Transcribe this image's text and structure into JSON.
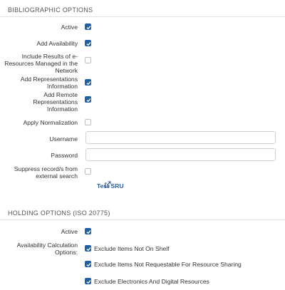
{
  "bibliographic": {
    "title": "BIBLIOGRAPHIC OPTIONS",
    "active_label": "Active",
    "active_checked": true,
    "add_availability_label": "Add Availability",
    "add_availability_checked": true,
    "include_results_label_1": "Include Results of e-",
    "include_results_label_2": "Resources Managed in the",
    "include_results_label_3": "Network",
    "include_results_checked": false,
    "add_representations_label_1": "Add Representations",
    "add_representations_label_2": "Information",
    "add_representations_checked": true,
    "add_remote_label_1": "Add Remote",
    "add_remote_label_2": "Representations",
    "add_remote_label_3": "Information",
    "add_remote_checked": true,
    "apply_normalization_label": "Apply Normalization",
    "apply_normalization_checked": false,
    "username_label": "Username",
    "username_value": "",
    "password_label": "Password",
    "password_value": "",
    "suppress_label_1": "Suppress record/s from",
    "suppress_label_2": "external search",
    "suppress_checked": false,
    "test_sru_label": "Test SRU"
  },
  "holding": {
    "title": "HOLDING OPTIONS (ISO 20775)",
    "active_label": "Active",
    "active_checked": true,
    "availability_label_1": "Availability Calculation",
    "availability_label_2": "Options:",
    "options": [
      {
        "label": "Exclude Items Not On Shelf",
        "checked": true
      },
      {
        "label": "Exclude Items Not Requestable For Resource Sharing",
        "checked": true
      },
      {
        "label": "Exclude Electronics And Digital Resources",
        "checked": true
      }
    ]
  },
  "colors": {
    "accent": "#1f5ea8",
    "link": "#2a5c98"
  },
  "icons": {
    "external_link": "external-link-icon",
    "check": "check-icon"
  }
}
